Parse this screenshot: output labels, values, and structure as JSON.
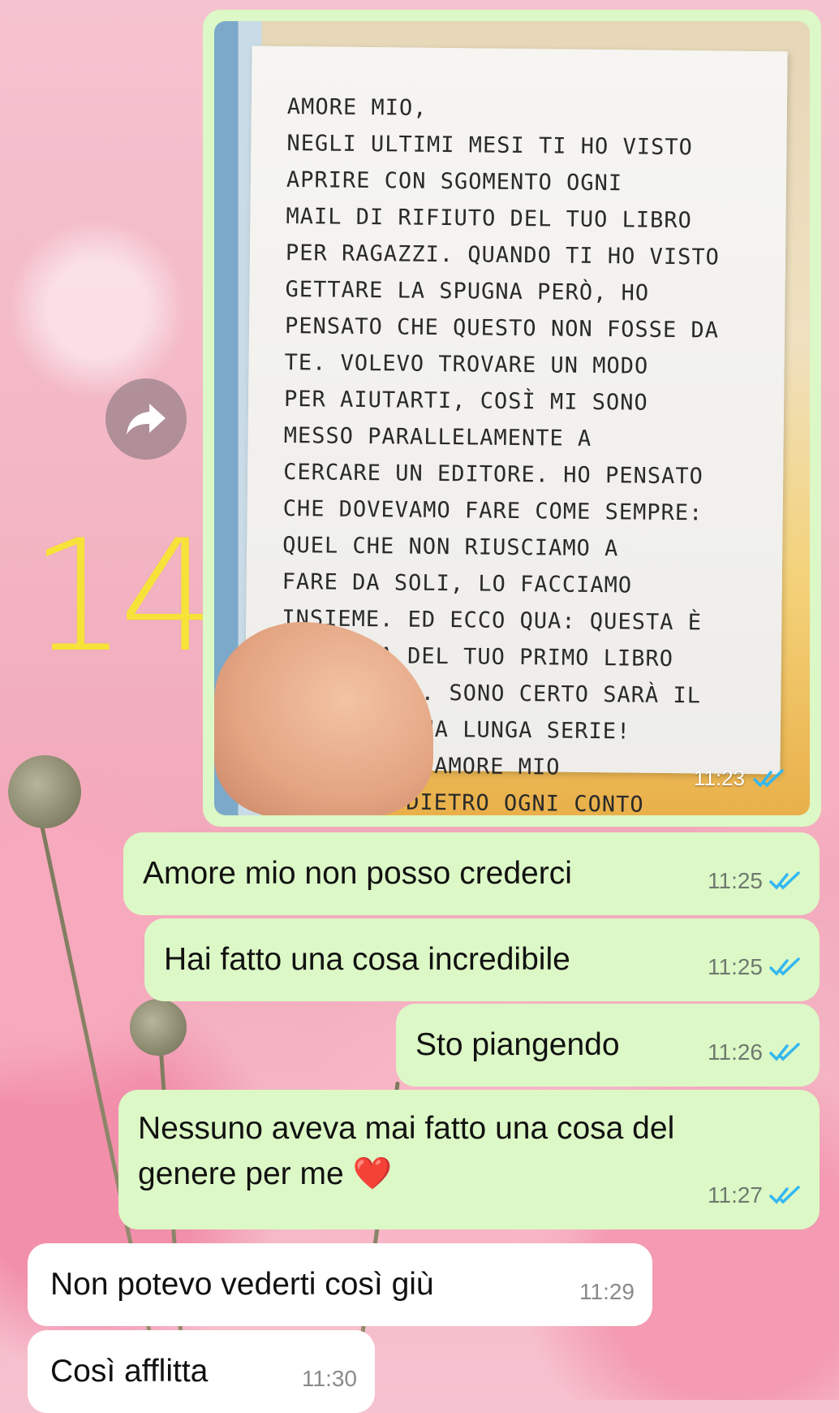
{
  "colors": {
    "outgoing_bubble": "#dcf8c6",
    "incoming_bubble": "#ffffff",
    "read_ticks": "#34b7f1",
    "date_overlay": "#f7e23a"
  },
  "overlay": {
    "date_number": "14"
  },
  "forward_icon": "forward-arrow-icon",
  "image_message": {
    "note_text": "AMORE MIO,\nNEGLI ULTIMI MESI TI HO VISTO\nAPRIRE CON SGOMENTO OGNI\nMAIL DI RIFIUTO DEL TUO LIBRO\nPER RAGAZZI. QUANDO TI HO VISTO\nGETTARE LA SPUGNA PERÒ, HO\nPENSATO CHE QUESTO NON FOSSE DA\nTE. VOLEVO TROVARE UN MODO\nPER AIUTARTI, COSÌ MI SONO\nMESSO PARALLELAMENTE A\nCERCARE UN EDITORE. HO PENSATO\nCHE DOVEVAMO FARE COME SEMPRE:\nQUEL CHE NON RIUSCIAMO A\nFARE DA SOLI, LO FACCIAMO\nINSIEME. ED ECCO QUA: QUESTA È\nLA COPIA DEL TUO PRIMO LIBRO\nPUBBLICATO. SONO CERTO SARÀ IL\nPRIMO DI UNA LUNGA SERIE!\n   AD MAIORA, AMORE MIO\nRICORDA: DIETRO OGNI CONTO\nALLA ROVESCIA C'È UNA POSSIBILITÀ\n   DI RINASCITA!",
    "time": "11:23",
    "status": "read"
  },
  "messages": [
    {
      "direction": "out",
      "text": "Amore mio non posso crederci",
      "time": "11:25",
      "status": "read"
    },
    {
      "direction": "out",
      "text": "Hai fatto una cosa incredibile",
      "time": "11:25",
      "status": "read"
    },
    {
      "direction": "out",
      "text": "Sto piangendo",
      "time": "11:26",
      "status": "read"
    },
    {
      "direction": "out",
      "text": "Nessuno aveva mai fatto una cosa del genere per me ❤️",
      "time": "11:27",
      "status": "read"
    },
    {
      "direction": "in",
      "text": "Non potevo vederti così giù",
      "time": "11:29"
    },
    {
      "direction": "in",
      "text": "Così afflitta",
      "time": "11:30"
    }
  ]
}
